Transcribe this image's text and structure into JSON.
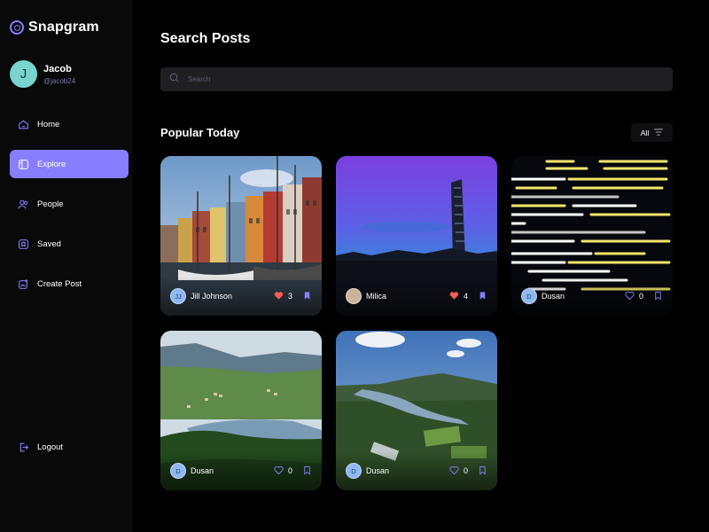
{
  "app": {
    "name": "Snapgram"
  },
  "user": {
    "name": "Jacob",
    "handle": "@jacob24",
    "initial": "J"
  },
  "nav": [
    {
      "label": "Home",
      "icon": "home-icon"
    },
    {
      "label": "Explore",
      "icon": "explore-icon",
      "active": true
    },
    {
      "label": "People",
      "icon": "people-icon"
    },
    {
      "label": "Saved",
      "icon": "saved-icon"
    },
    {
      "label": "Create Post",
      "icon": "create-post-icon"
    }
  ],
  "logout": {
    "label": "Logout",
    "icon": "logout-icon"
  },
  "main": {
    "title": "Search Posts",
    "search": {
      "placeholder": "Search",
      "value": ""
    },
    "section_title": "Popular Today",
    "filter": {
      "label": "All"
    }
  },
  "posts": [
    {
      "author": "Jill Johnson",
      "initials": "JJ",
      "likes": "3",
      "liked": true,
      "saved": true,
      "image": "harbor houses photo"
    },
    {
      "author": "Milica",
      "initials": "",
      "likes": "4",
      "liked": true,
      "saved": true,
      "image": "tower at dusk photo"
    },
    {
      "author": "Dusan",
      "initials": "D",
      "likes": "0",
      "liked": false,
      "saved": false,
      "image": "code screen photo"
    },
    {
      "author": "Dusan",
      "initials": "D",
      "likes": "0",
      "liked": false,
      "saved": false,
      "image": "lake valley photo"
    },
    {
      "author": "Dusan",
      "initials": "D",
      "likes": "0",
      "liked": false,
      "saved": false,
      "image": "river aerial photo"
    }
  ],
  "colors": {
    "accent": "#877eff",
    "like": "#ff5a5a",
    "bg": "#000000",
    "sidebar": "#09090a",
    "input": "#1f1f22"
  }
}
